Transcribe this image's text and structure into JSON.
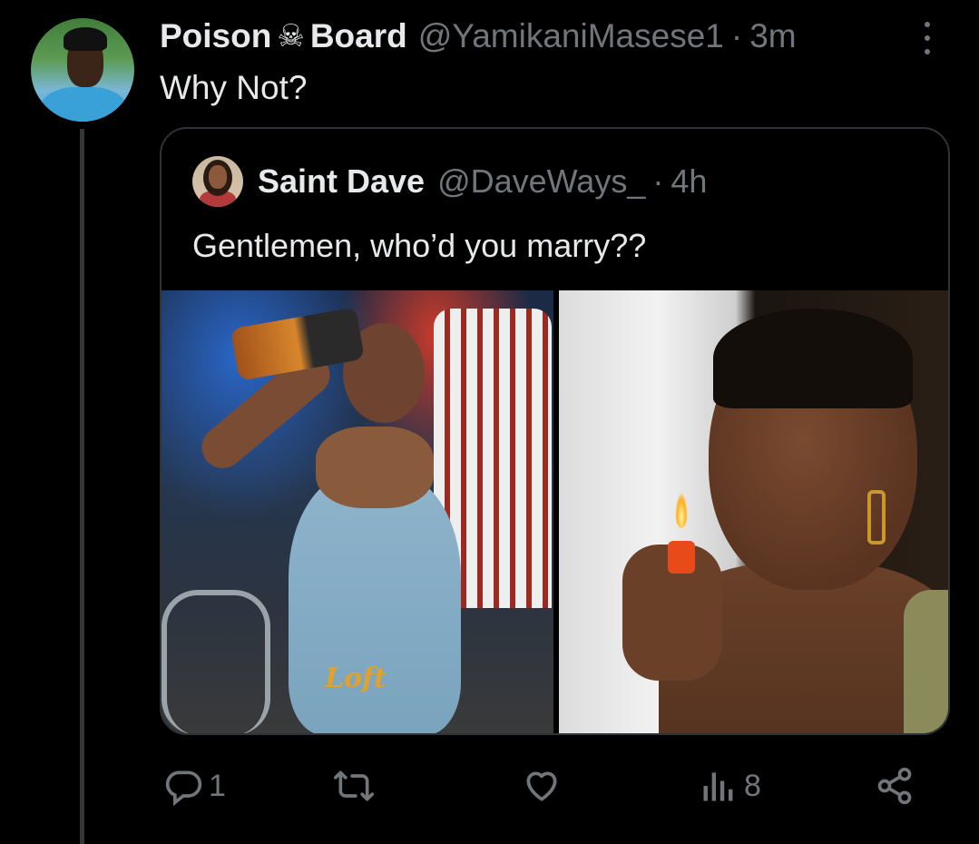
{
  "tweet": {
    "display_name_part1": "Poison",
    "display_name_icon": "☠",
    "display_name_part2": "Board",
    "handle": "@YamikaniMasese1",
    "separator": "·",
    "time": "3m",
    "text": "Why Not?"
  },
  "quoted": {
    "display_name": "Saint Dave",
    "handle": "@DaveWays_",
    "separator": "·",
    "time": "4h",
    "text": "Gentlemen, who’d you marry??",
    "media": {
      "left_logo_text": "Loft"
    }
  },
  "actions": {
    "reply_count": "1",
    "retweet_count": "",
    "like_count": "",
    "views_count": "8"
  },
  "icons": {
    "more": "more-vertical-icon",
    "reply": "reply-icon",
    "retweet": "retweet-icon",
    "like": "heart-icon",
    "views": "views-icon",
    "share": "share-icon"
  },
  "colors": {
    "background": "#000000",
    "primary_text": "#e7e9ea",
    "secondary_text": "#71767b",
    "border": "#2f3336"
  }
}
